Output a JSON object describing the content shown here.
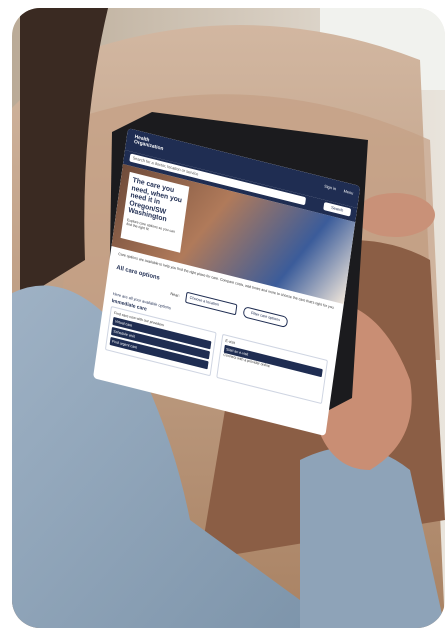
{
  "screen": {
    "header_logo_line1": "Health",
    "header_logo_line2": "Organization",
    "sign_in": "Sign in",
    "menu": "Menu",
    "search_placeholder": "Search for a doctor, location or service",
    "search_button": "Search",
    "hero_heading": "The care you need, when you need it in Oregon/SW Washington",
    "hero_subtext": "Explore care options so you can find the right fit",
    "intro_text": "Care options are available to help you find the right place for care. Compare costs, wait times and more to choose the care that's right for you.",
    "section_title": "All care options",
    "filter_label": "Near:",
    "filter_select": "Choose a location",
    "filter_button": "Filter care options",
    "see_all": "Here are all your available options",
    "subsection": "Immediate care",
    "col1_text": "Find care now with our providers",
    "col1_btn1": "Virtual care",
    "col1_btn2": "Schedule visit",
    "col1_btn3": "Find urgent care",
    "col2_title": "E-visit",
    "col2_btn1": "Start an e-visit",
    "col2_text": "Connect with a provider online"
  },
  "colors": {
    "brand_navy": "#1f2d52",
    "couch": "#c9a58c",
    "sweater": "#8ea3b8"
  }
}
